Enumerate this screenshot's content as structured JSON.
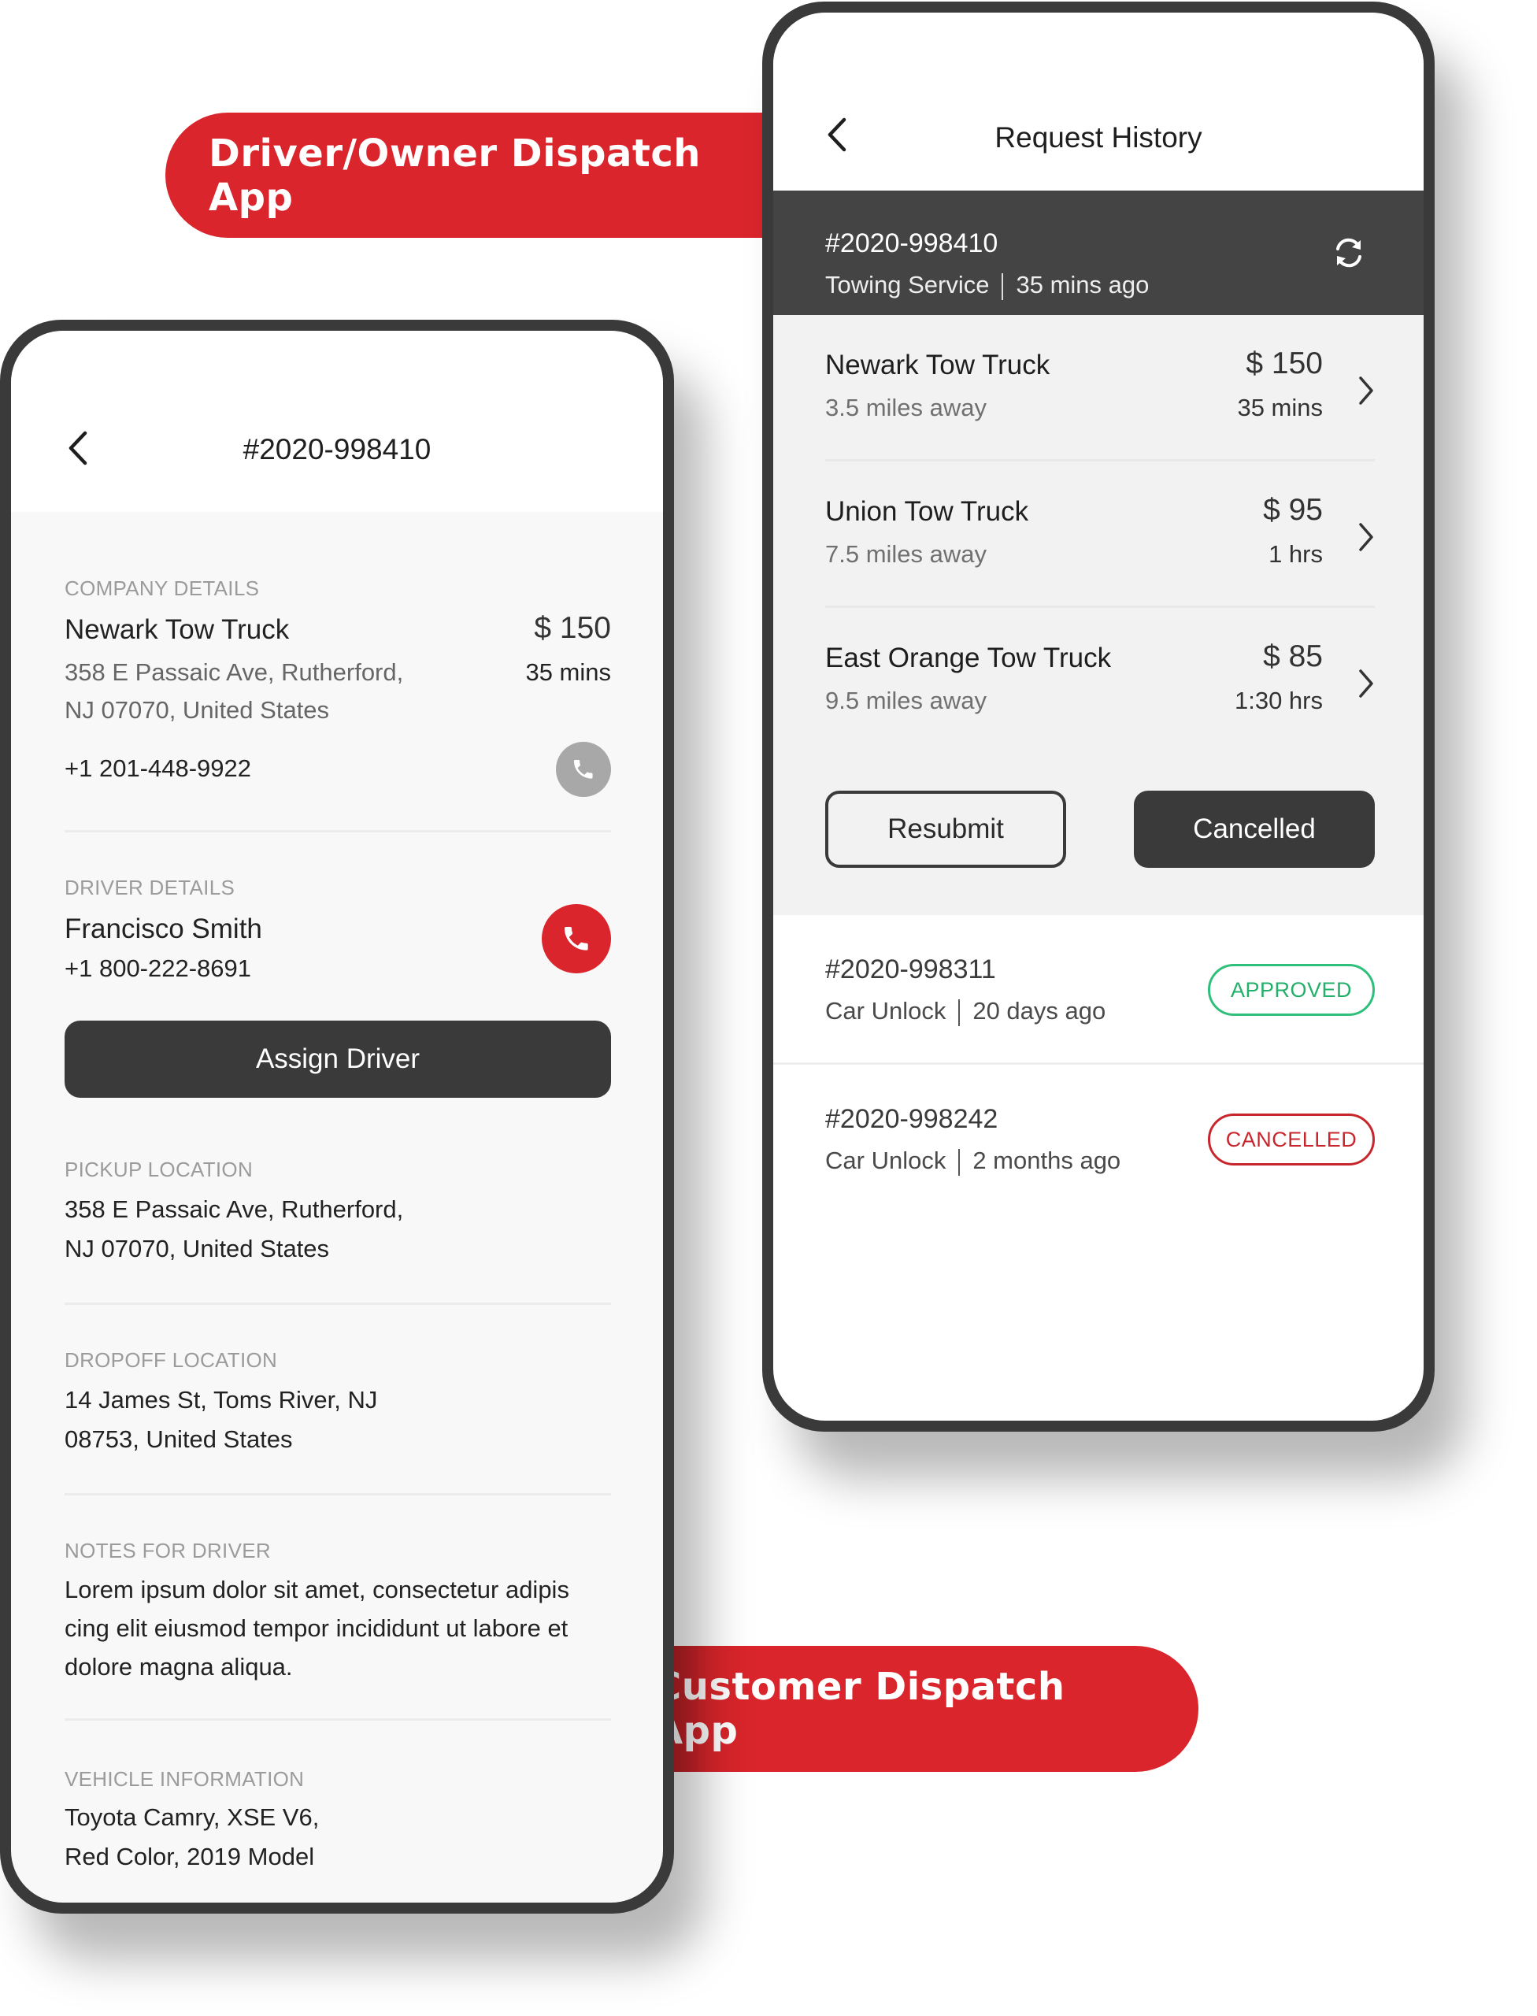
{
  "banners": {
    "top_label": "Driver/Owner Dispatch App",
    "bottom_label": "Customer Dispatch App"
  },
  "colors": {
    "brand_red": "#D9252B",
    "dark": "#3A3A3A",
    "approved_green": "#22B06A",
    "cancelled_red": "#C8262D"
  },
  "customer_app": {
    "title": "Request History",
    "back_icon": "chevron-left-icon",
    "active_request": {
      "id": "#2020-998410",
      "service": "Towing Service",
      "time": "35 mins ago",
      "icon": "refresh-icon"
    },
    "offers": [
      {
        "name": "Newark Tow Truck",
        "distance": "3.5 miles away",
        "price": "$ 150",
        "eta": "35 mins"
      },
      {
        "name": "Union Tow Truck",
        "distance": "7.5 miles away",
        "price": "$ 95",
        "eta": "1 hrs"
      },
      {
        "name": "East Orange Tow Truck",
        "distance": "9.5 miles away",
        "price": "$ 85",
        "eta": "1:30 hrs"
      }
    ],
    "buttons": {
      "resubmit": "Resubmit",
      "cancelled": "Cancelled"
    },
    "history": [
      {
        "id": "#2020-998311",
        "service": "Car Unlock",
        "time": "20 days ago",
        "status": "APPROVED"
      },
      {
        "id": "#2020-998242",
        "service": "Car Unlock",
        "time": "2 months ago",
        "status": "CANCELLED"
      }
    ]
  },
  "driver_app": {
    "title": "#2020-998410",
    "back_icon": "chevron-left-icon",
    "company": {
      "label": "COMPANY DETAILS",
      "name": "Newark Tow Truck",
      "address_line1": "358 E Passaic Ave, Rutherford,",
      "address_line2": "NJ 07070, United States",
      "phone": "+1 201-448-9922",
      "price": "$ 150",
      "eta": "35 mins"
    },
    "driver": {
      "label": "DRIVER DETAILS",
      "name": "Francisco Smith",
      "phone": "+1 800-222-8691"
    },
    "assign_button": "Assign Driver",
    "pickup": {
      "label": "PICKUP LOCATION",
      "line1": "358 E Passaic Ave, Rutherford,",
      "line2": "NJ 07070, United States"
    },
    "dropoff": {
      "label": "DROPOFF LOCATION",
      "line1": "14 James St, Toms River, NJ",
      "line2": "08753, United States"
    },
    "notes": {
      "label": "NOTES FOR DRIVER",
      "line1": "Lorem ipsum dolor sit amet, consectetur adipis",
      "line2": "cing elit eiusmod tempor incididunt ut labore et",
      "line3": "dolore magna aliqua."
    },
    "vehicle": {
      "label": "VEHICLE INFORMATION",
      "line1": "Toyota Camry, XSE V6,",
      "line2": "Red Color, 2019 Model"
    }
  }
}
